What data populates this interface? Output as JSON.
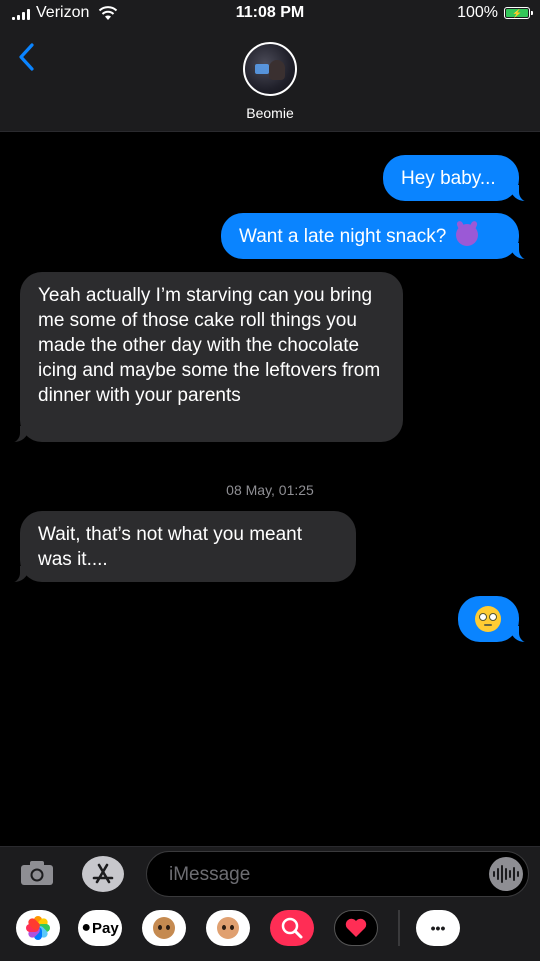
{
  "status_bar": {
    "carrier": "Verizon",
    "time": "11:08 PM",
    "battery_percent": "100%"
  },
  "header": {
    "contact_name": "Beomie"
  },
  "messages": [
    {
      "direction": "outgoing",
      "text": "Hey baby..."
    },
    {
      "direction": "outgoing",
      "text": "Want a late night snack?",
      "emoji": "smiling-devil-emoji"
    },
    {
      "direction": "incoming",
      "text": "Yeah actually I’m starving can you bring me some of those cake roll things you made the other day with the chocolate icing and maybe some the leftovers from dinner with your parents"
    },
    {
      "direction": "incoming",
      "text": "Wait, that’s not what you meant was it...."
    },
    {
      "direction": "outgoing",
      "text": "",
      "emoji": "eye-roll-emoji"
    }
  ],
  "timestamp": "08 May, 01:25",
  "input": {
    "placeholder": "iMessage"
  },
  "app_tray": {
    "apple_pay_label": "Pay",
    "more_label": "•••"
  },
  "colors": {
    "outgoing_bubble": "#0a84ff",
    "incoming_bubble": "#2c2c2e",
    "background": "#000000"
  }
}
